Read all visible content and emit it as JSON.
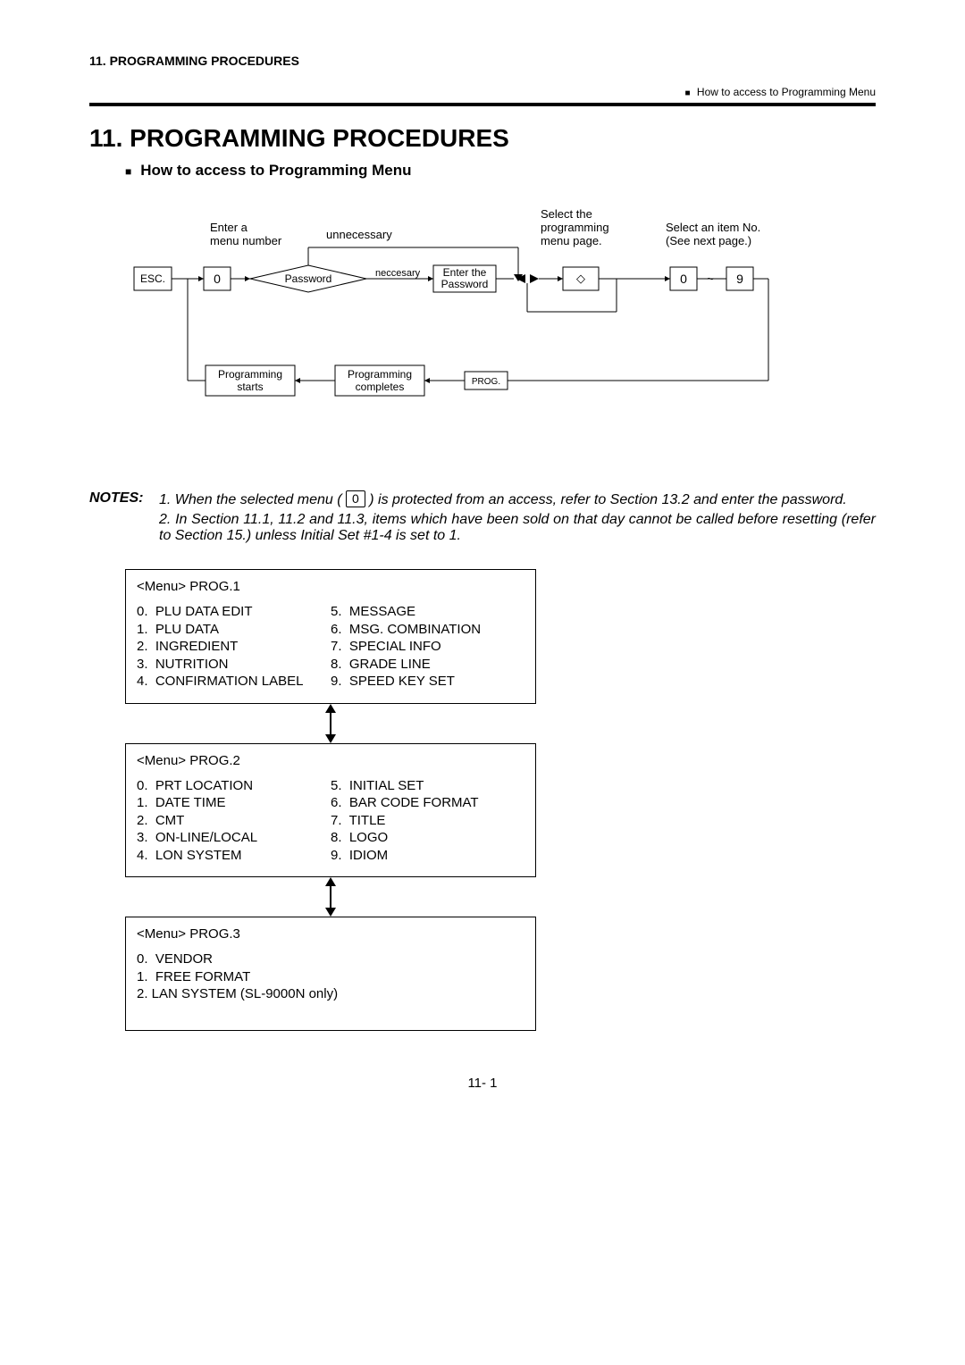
{
  "header_small": "11.  PROGRAMMING PROCEDURES",
  "top_right_note": "How to access to Programming Menu",
  "main_title": "11.  PROGRAMMING PROCEDURES",
  "subsection_title": "How to access to Programming Menu",
  "flow": {
    "enter_menu_label": "Enter a\nmenu number",
    "esc": "ESC.",
    "zero": "0",
    "password_decision": "Password",
    "unnecessary": "unnecessary",
    "neccesary": "neccesary",
    "enter_password": "Enter the\nPassword",
    "select_prog_page": "Select the\nprogramming\nmenu page.",
    "diamond_icon": "◇",
    "select_item": "Select an item No.\n(See next page.)",
    "zero2": "0",
    "tilde": "~",
    "nine": "9",
    "prog_starts": "Programming\nstarts",
    "prog_completes": "Programming\ncompletes",
    "prog_key": "PROG."
  },
  "notes_label": "NOTES:",
  "notes": {
    "note1_pre": "1.  When the selected menu ( ",
    "note1_key": "0",
    "note1_post": " ) is protected from  an access, refer to Section 13.2 and enter the password.",
    "note2": "2.  In Section 11.1, 11.2 and 11.3, items which have been sold on that day cannot be called before resetting (refer to Section 15.) unless Initial Set #1-4 is set to 1."
  },
  "menus": {
    "prog1": {
      "title": "<Menu> PROG.1",
      "left": "0.  PLU DATA EDIT\n1.  PLU DATA\n2.  INGREDIENT\n3.  NUTRITION\n4.  CONFIRMATION LABEL",
      "right": "5.  MESSAGE\n6.  MSG. COMBINATION\n7.  SPECIAL INFO\n8.  GRADE LINE\n9.  SPEED KEY SET"
    },
    "prog2": {
      "title": "<Menu> PROG.2",
      "left": "0.  PRT LOCATION\n1.  DATE TIME\n2.  CMT\n3.  ON-LINE/LOCAL\n4.  LON SYSTEM",
      "right": "5.  INITIAL SET\n6.  BAR CODE FORMAT\n7.  TITLE\n8.  LOGO\n9.  IDIOM"
    },
    "prog3": {
      "title": "<Menu> PROG.3",
      "body": "0.  VENDOR\n1.  FREE FORMAT\n2. LAN SYSTEM (SL-9000N only)"
    }
  },
  "page_num": "11- 1"
}
